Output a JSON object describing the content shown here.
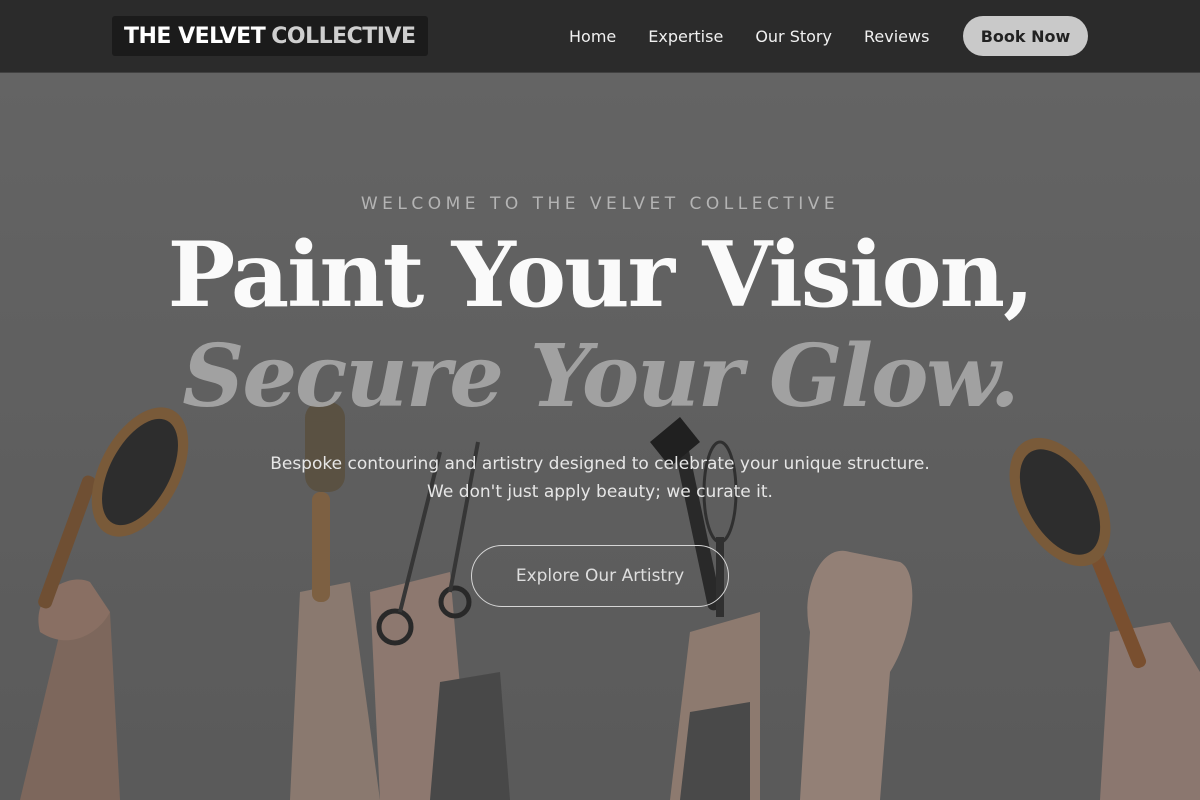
{
  "brand": {
    "name_part1": "THE VELVET",
    "name_part2": "COLLECTIVE"
  },
  "nav": {
    "items": [
      {
        "label": "Home"
      },
      {
        "label": "Expertise"
      },
      {
        "label": "Our Story"
      },
      {
        "label": "Reviews"
      }
    ]
  },
  "header": {
    "cta_label": "Book Now"
  },
  "hero": {
    "eyebrow": "WELCOME TO THE VELVET COLLECTIVE",
    "title_line1": "Paint Your Vision,",
    "title_line2": "Secure Your Glow.",
    "subtitle": "Bespoke contouring and artistry designed to celebrate your unique structure. We don't just apply beauty; we curate it.",
    "cta_label": "Explore Our Artistry",
    "background_icons": [
      "paddle-brush-icon",
      "round-brush-icon",
      "scissors-icon",
      "tint-brush-icon",
      "whisk-icon",
      "hand-icon"
    ]
  },
  "colors": {
    "header_bg": "#2b2b2b",
    "hero_bg": "#6e6e6e",
    "book_button_bg": "#c9c9c9"
  }
}
